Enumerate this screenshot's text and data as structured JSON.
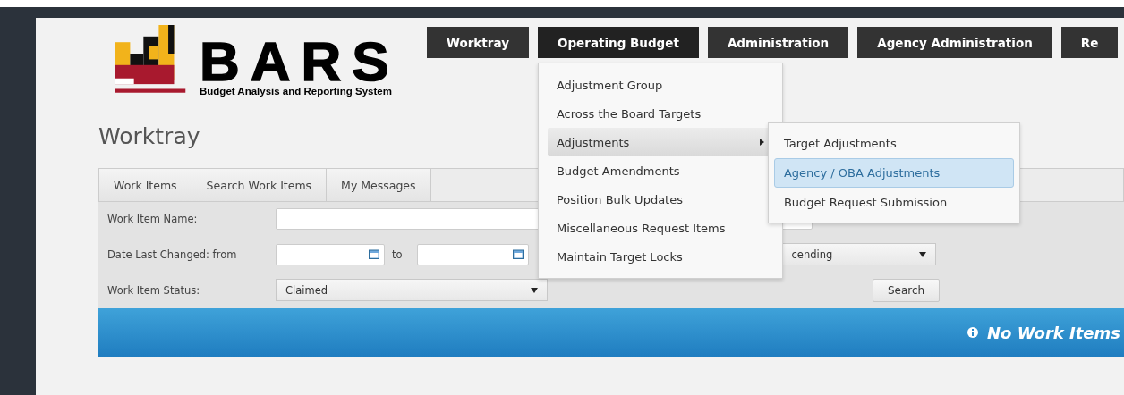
{
  "logo": {
    "title": "BARS",
    "subtitle": "Budget Analysis and Reporting System"
  },
  "nav": [
    {
      "label": "Worktray",
      "open": false
    },
    {
      "label": "Operating Budget",
      "open": true
    },
    {
      "label": "Administration",
      "open": false
    },
    {
      "label": "Agency Administration",
      "open": false
    },
    {
      "label": "Re",
      "open": false
    }
  ],
  "menu": [
    {
      "label": "Adjustment Group",
      "highlighted": false,
      "has_submenu": false
    },
    {
      "label": "Across the Board Targets",
      "highlighted": false,
      "has_submenu": false
    },
    {
      "label": "Adjustments",
      "highlighted": true,
      "has_submenu": true
    },
    {
      "label": "Budget Amendments",
      "highlighted": false,
      "has_submenu": false
    },
    {
      "label": "Position Bulk Updates",
      "highlighted": false,
      "has_submenu": false
    },
    {
      "label": "Miscellaneous Request Items",
      "highlighted": false,
      "has_submenu": false
    },
    {
      "label": "Maintain Target Locks",
      "highlighted": false,
      "has_submenu": false
    }
  ],
  "submenu": [
    {
      "label": "Target Adjustments",
      "highlighted": false
    },
    {
      "label": "Agency / OBA Adjustments",
      "highlighted": true
    },
    {
      "label": "Budget Request Submission",
      "highlighted": false
    }
  ],
  "page_title": "Worktray",
  "tabs": [
    {
      "label": "Work Items"
    },
    {
      "label": "Search Work Items"
    },
    {
      "label": "My Messages"
    }
  ],
  "form": {
    "name_label": "Work Item Name:",
    "date_label": "Date Last Changed: from",
    "to_label": "to",
    "status_label": "Work Item Status:",
    "status_value": "Claimed",
    "sort_value": "cending",
    "search_button": "Search"
  },
  "banner": {
    "message": "No Work Items"
  }
}
